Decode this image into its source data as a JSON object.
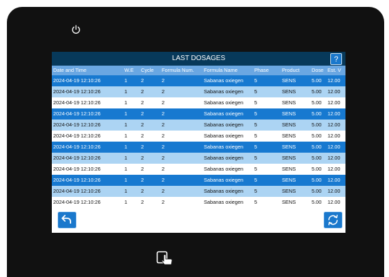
{
  "screen": {
    "title": "LAST DOSAGES",
    "help_label": "?",
    "columns": [
      "Date and Time",
      "W.E",
      "Cycle",
      "Formula Num.",
      "Formula Name",
      "Phase",
      "Product",
      "Dose",
      "Est. V"
    ],
    "rows": [
      {
        "date": "2024-04-19 12:10:26",
        "we": "1",
        "cycle": "2",
        "num": "2",
        "name": "Sabanas oxiegen",
        "phase": "5",
        "product": "SENS",
        "dose": "5.00",
        "est": "12.00"
      },
      {
        "date": "2024-04-19 12:10:26",
        "we": "1",
        "cycle": "2",
        "num": "2",
        "name": "Sabanas oxiegen",
        "phase": "5",
        "product": "SENS",
        "dose": "5.00",
        "est": "12.00"
      },
      {
        "date": "2024-04-19 12:10:26",
        "we": "1",
        "cycle": "2",
        "num": "2",
        "name": "Sabanas oxiegen",
        "phase": "5",
        "product": "SENS",
        "dose": "5.00",
        "est": "12.00"
      },
      {
        "date": "2024-04-19 12:10:26",
        "we": "1",
        "cycle": "2",
        "num": "2",
        "name": "Sabanas oxiegen",
        "phase": "5",
        "product": "SENS",
        "dose": "5.00",
        "est": "12.00"
      },
      {
        "date": "2024-04-19 12:10:26",
        "we": "1",
        "cycle": "2",
        "num": "2",
        "name": "Sabanas oxiegen",
        "phase": "5",
        "product": "SENS",
        "dose": "5.00",
        "est": "12.00"
      },
      {
        "date": "2024-04-19 12:10:26",
        "we": "1",
        "cycle": "2",
        "num": "2",
        "name": "Sabanas oxiegen",
        "phase": "5",
        "product": "SENS",
        "dose": "5.00",
        "est": "12.00"
      },
      {
        "date": "2024-04-19 12:10:26",
        "we": "1",
        "cycle": "2",
        "num": "2",
        "name": "Sabanas oxiegen",
        "phase": "5",
        "product": "SENS",
        "dose": "5.00",
        "est": "12.00"
      },
      {
        "date": "2024-04-19 12:10:26",
        "we": "1",
        "cycle": "2",
        "num": "2",
        "name": "Sabanas oxiegen",
        "phase": "5",
        "product": "SENS",
        "dose": "5.00",
        "est": "12.00"
      },
      {
        "date": "2024-04-19 12:10:26",
        "we": "1",
        "cycle": "2",
        "num": "2",
        "name": "Sabanas oxiegen",
        "phase": "5",
        "product": "SENS",
        "dose": "5.00",
        "est": "12.00"
      },
      {
        "date": "2024-04-19 12:10:26",
        "we": "1",
        "cycle": "2",
        "num": "2",
        "name": "Sabanas oxiegen",
        "phase": "5",
        "product": "SENS",
        "dose": "5.00",
        "est": "12.00"
      },
      {
        "date": "2024-04-19 12:10:26",
        "we": "1",
        "cycle": "2",
        "num": "2",
        "name": "Sabanas oxiegen",
        "phase": "5",
        "product": "SENS",
        "dose": "5.00",
        "est": "12.00"
      },
      {
        "date": "2024-04-19 12:10:26",
        "we": "1",
        "cycle": "2",
        "num": "2",
        "name": "Sabanas oxiegen",
        "phase": "5",
        "product": "SENS",
        "dose": "5.00",
        "est": "12.00"
      }
    ]
  },
  "colors": {
    "bezel": "#111111",
    "title_bar": "#07395a",
    "header_row": "#6aa7e2",
    "row_dark": "#1779d0",
    "row_light": "#acd4f3",
    "row_white": "#ffffff",
    "button": "#1a78cc"
  },
  "icons": {
    "power": "power-icon",
    "help": "help-icon",
    "back": "back-arrow-icon",
    "refresh": "refresh-icon",
    "touch": "touch-hand-icon"
  }
}
